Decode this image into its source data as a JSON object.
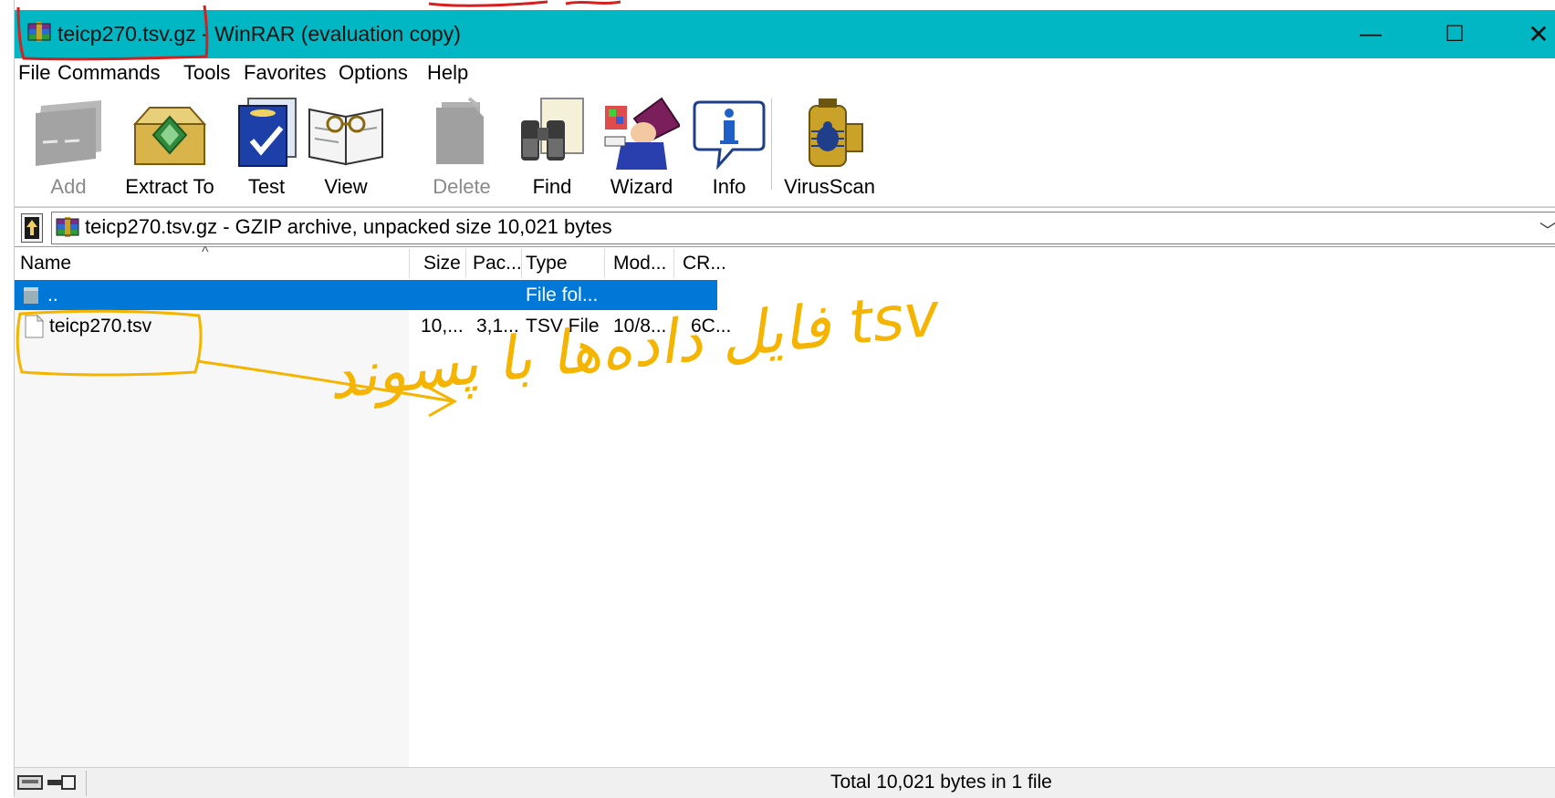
{
  "window": {
    "title": "teicp270.tsv.gz - WinRAR (evaluation copy)",
    "controls": {
      "minimize": "—",
      "maximize": "☐",
      "close": "✕"
    }
  },
  "menu": [
    "File",
    "Commands",
    "Tools",
    "Favorites",
    "Options",
    "Help"
  ],
  "toolbar": [
    {
      "label": "Add",
      "icon": "add-icon",
      "enabled": false
    },
    {
      "label": "Extract To",
      "icon": "extract-to-icon",
      "enabled": true
    },
    {
      "label": "Test",
      "icon": "test-icon",
      "enabled": true
    },
    {
      "label": "View",
      "icon": "view-icon",
      "enabled": true
    },
    {
      "label": "Delete",
      "icon": "delete-icon",
      "enabled": false
    },
    {
      "label": "Find",
      "icon": "find-icon",
      "enabled": true
    },
    {
      "label": "Wizard",
      "icon": "wizard-icon",
      "enabled": true
    },
    {
      "label": "Info",
      "icon": "info-icon",
      "enabled": true
    },
    {
      "label": "VirusScan",
      "icon": "virusscan-icon",
      "enabled": true
    }
  ],
  "address": {
    "text": "teicp270.tsv.gz - GZIP archive, unpacked size 10,021 bytes"
  },
  "columns": [
    "Name",
    "Size",
    "Pac...",
    "Type",
    "Mod...",
    "CR..."
  ],
  "rows": [
    {
      "name": "..",
      "size": "",
      "packed": "",
      "type": "File fol...",
      "modified": "",
      "crc": "",
      "selected": true
    },
    {
      "name": "teicp270.tsv",
      "size": "10,...",
      "packed": "3,1...",
      "type": "TSV File",
      "modified": "10/8...",
      "crc": "6C...",
      "selected": false
    }
  ],
  "status": {
    "text": "Total 10,021 bytes in 1 file"
  },
  "annotation": {
    "text": "فایل داده‌ها با پسوند tsv",
    "color": "#f5b400",
    "highlight_color": "#d62020"
  }
}
